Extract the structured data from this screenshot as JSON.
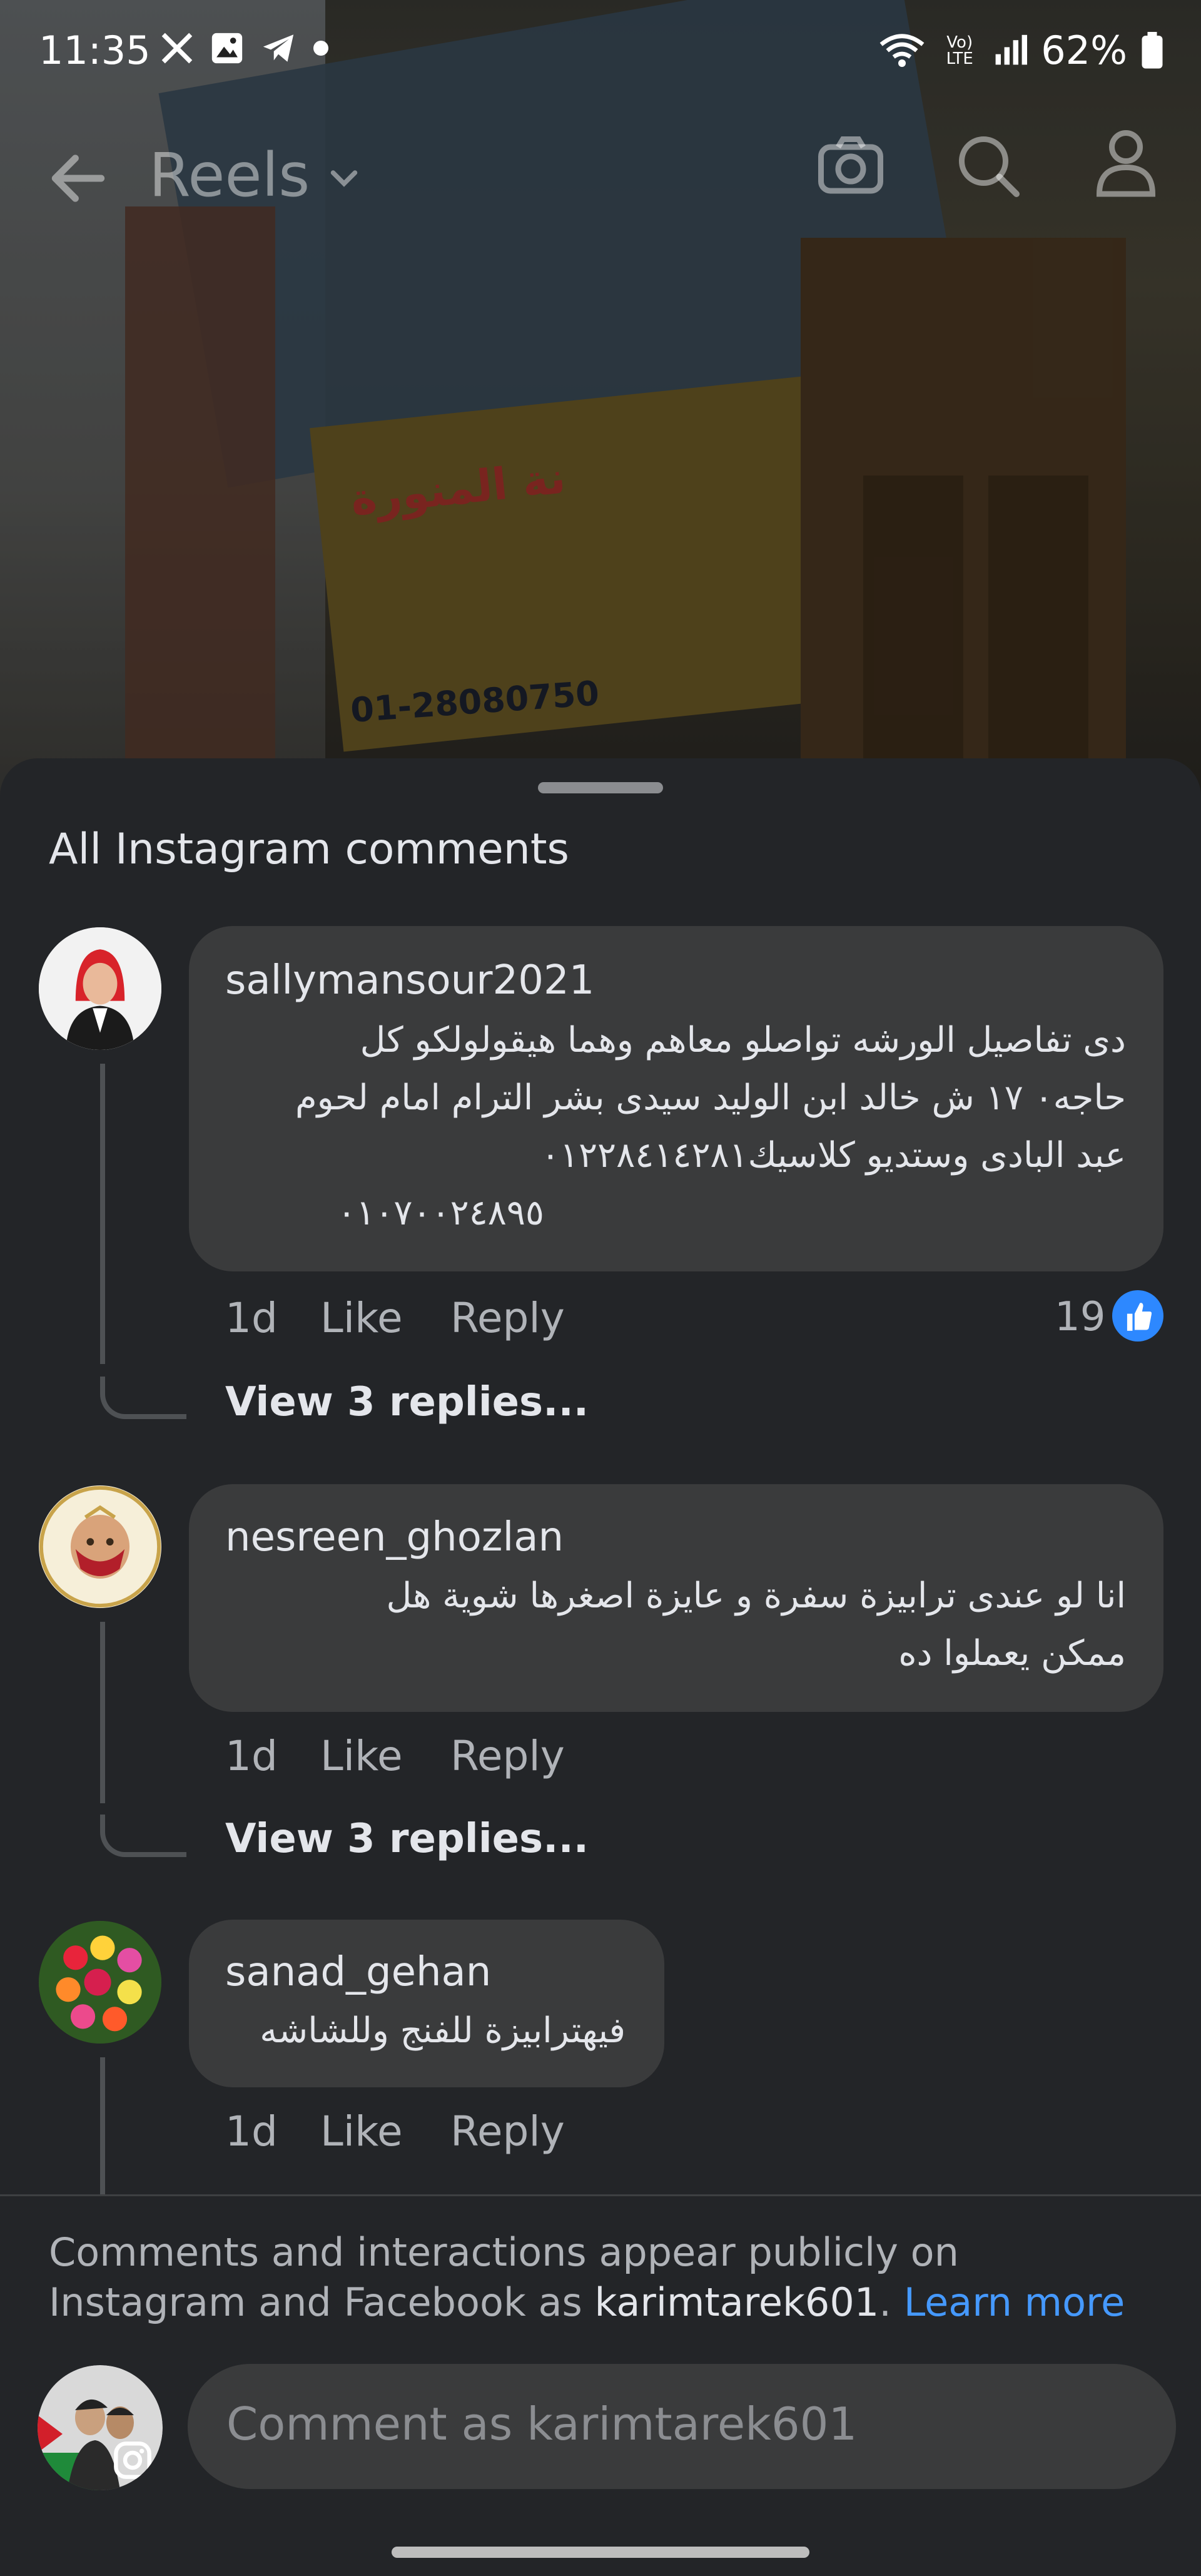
{
  "status_bar": {
    "time": "11:35",
    "battery": "62%",
    "network": "Vo) LTE"
  },
  "header": {
    "title": "Reels"
  },
  "background": {
    "sign_text": "نة المنورة",
    "sign_phone": "01-28080750"
  },
  "sheet": {
    "title": "All Instagram comments"
  },
  "comments": [
    {
      "username": "sallymansour2021",
      "lines": [
        "دى تفاصيل الورشه تواصلو معاهم وهما هيقولولكو كل",
        "حاجه۰ ١٧ ش خالد ابن الوليد سيدى بشر الترام امام لحوم",
        "عبد البادى وستديو كلاسيك٠١٢٢٨٤١٤٢٨١",
        "٠١٠٧٠٠٢٤٨٩٥"
      ],
      "time": "1d",
      "like_label": "Like",
      "reply_label": "Reply",
      "like_count": "19",
      "view_replies": "View 3 replies..."
    },
    {
      "username": "nesreen_ghozlan",
      "lines": [
        "انا لو عندى  ترابيزة سفرة و عايزة اصغرها شوية هل",
        "ممكن يعملوا ده"
      ],
      "time": "1d",
      "like_label": "Like",
      "reply_label": "Reply",
      "view_replies": "View 3 replies..."
    },
    {
      "username": "sanad_gehan",
      "lines": [
        "فيهترابيزة للفنج وللشاشه"
      ],
      "time": "1d",
      "like_label": "Like",
      "reply_label": "Reply"
    }
  ],
  "footer": {
    "notice_prefix": "Comments and interactions appear publicly on Instagram and Facebook as ",
    "account": "karimtarek601",
    "notice_suffix": ". ",
    "learn_more": "Learn more",
    "comment_placeholder": "Comment as karimtarek601"
  },
  "colors": {
    "sheet_bg": "#232528",
    "bubble_bg": "#3a3b3c",
    "link_blue": "#4599ff",
    "like_blue": "#2d88ff"
  }
}
